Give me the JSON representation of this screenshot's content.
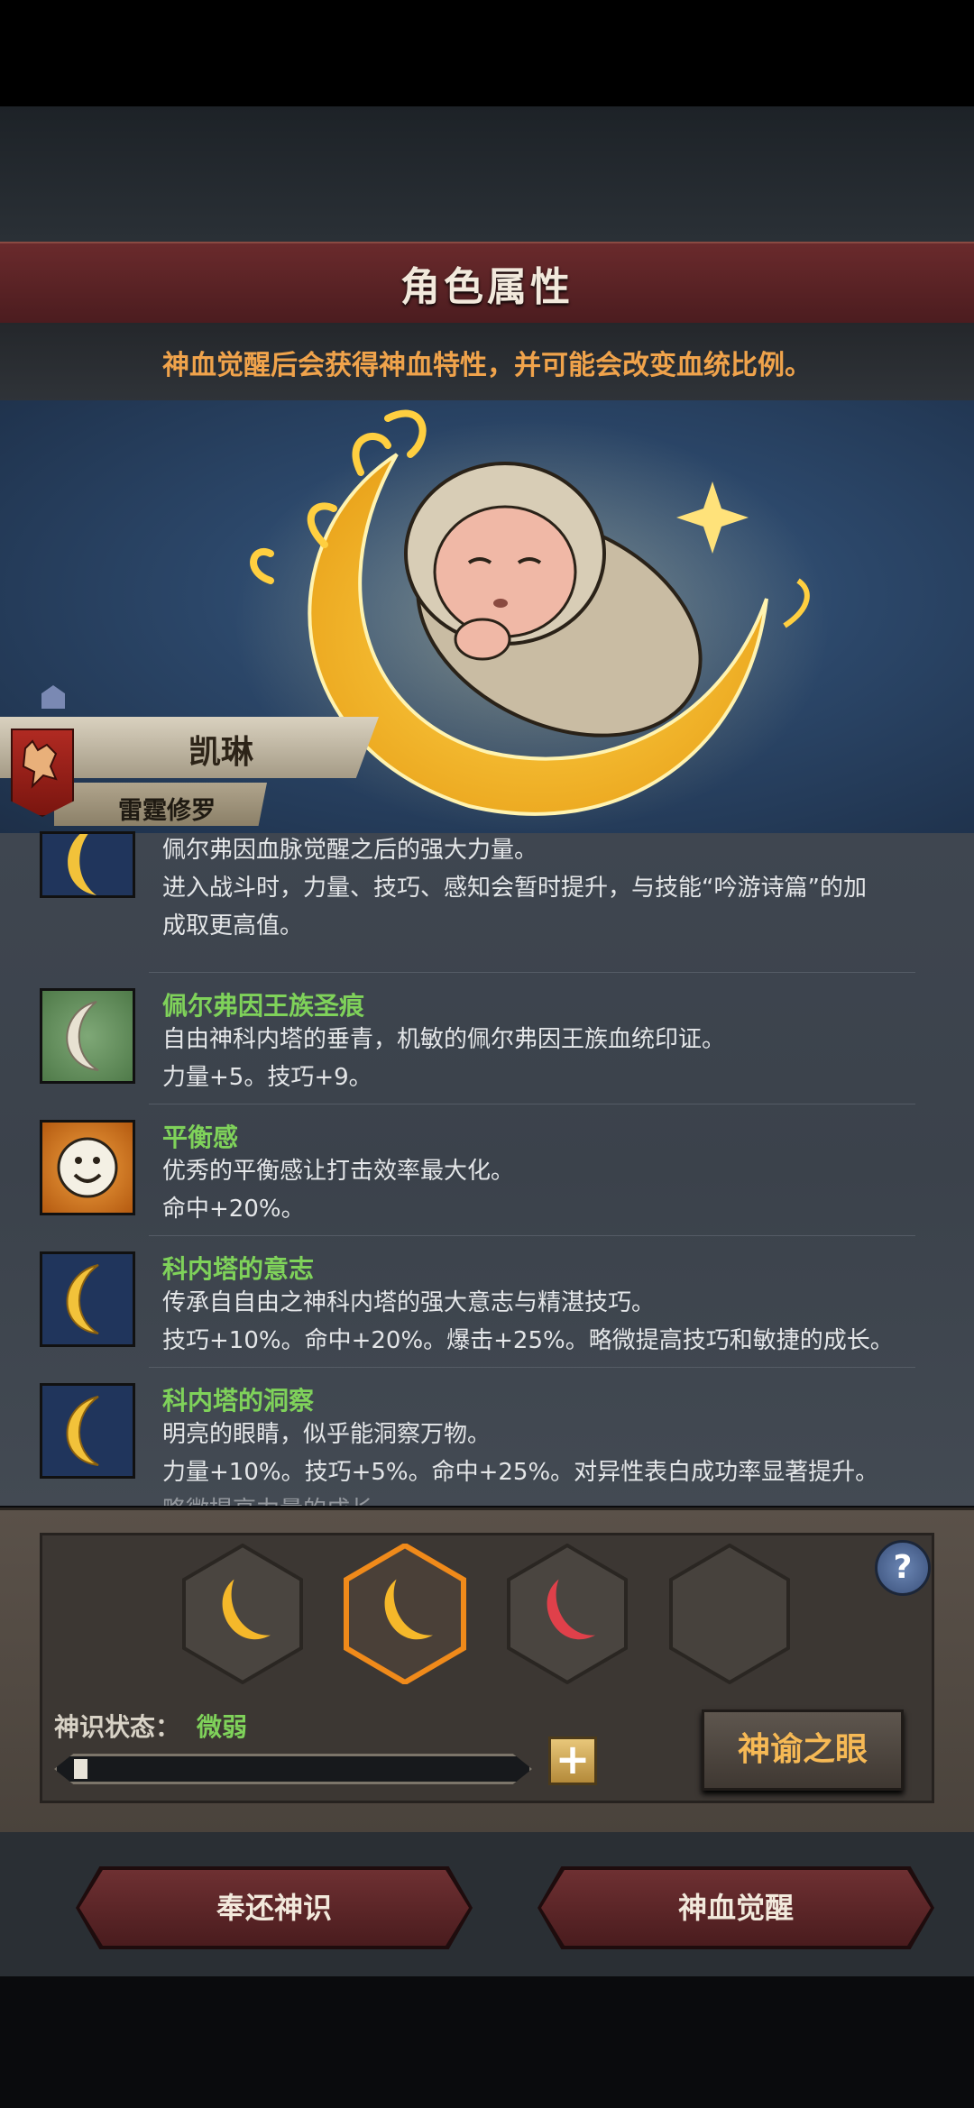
{
  "header": {
    "title": "角色属性",
    "notice": "神血觉醒后会获得神血特性，并可能会改变血统比例。"
  },
  "character": {
    "name": "凯琳",
    "class": "雷霆修罗"
  },
  "traits": [
    {
      "name": "",
      "icon": "crescent-moon-icon",
      "lines": [
        "佩尔弗因血脉觉醒之后的强大力量。",
        "进入战斗时，力量、技巧、感知会暂时提升，与技能“吟游诗篇”的加",
        "成取更高值。"
      ]
    },
    {
      "name": "佩尔弗因王族圣痕",
      "icon": "silver-crescent-icon",
      "lines": [
        "自由神科内塔的垂青，机敏的佩尔弗因王族血统印证。",
        "力量+5。技巧+9。"
      ]
    },
    {
      "name": "平衡感",
      "icon": "smiley-face-icon",
      "lines": [
        "优秀的平衡感让打击效率最大化。",
        "命中+20%。"
      ]
    },
    {
      "name": "科内塔的意志",
      "icon": "crescent-moon-icon",
      "lines": [
        "传承自自由之神科内塔的强大意志与精湛技巧。",
        "技巧+10%。命中+20%。爆击+25%。略微提高技巧和敏捷的成长。"
      ]
    },
    {
      "name": "科内塔的洞察",
      "icon": "crescent-moon-icon",
      "lines": [
        "明亮的眼睛，似乎能洞察万物。",
        "力量+10%。技巧+5%。命中+25%。对异性表白成功率显著提升。",
        "略微提高力量的成长。"
      ]
    }
  ],
  "divine_panel": {
    "slots": [
      "gold-crescent-icon",
      "gold-crescent-icon",
      "red-crescent-icon",
      "empty-slot"
    ],
    "selected_slot": 1,
    "help_label": "?",
    "state_label": "神识状态：",
    "state_value": "微弱",
    "progress": 0.03,
    "plus_label": "+",
    "oracle_button": "神谕之眼"
  },
  "footer": {
    "return_button": "奉还神识",
    "awaken_button": "神血觉醒"
  },
  "colors": {
    "trait_name": "#7fd25a",
    "notice": "#f0a34b",
    "oracle": "#f6b955"
  }
}
